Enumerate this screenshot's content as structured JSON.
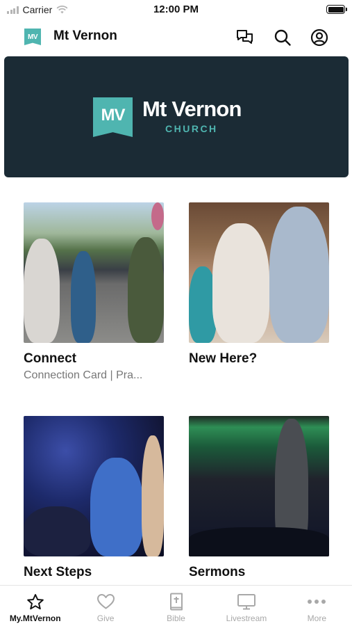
{
  "status": {
    "carrier": "Carrier",
    "time": "12:00 PM"
  },
  "header": {
    "logo_text": "MV",
    "title": "Mt Vernon"
  },
  "banner": {
    "mark": "MV",
    "name": "Mt Vernon",
    "subtitle": "CHURCH"
  },
  "cards": [
    {
      "title": "Connect",
      "subtitle": "Connection Card | Pra..."
    },
    {
      "title": "New Here?",
      "subtitle": ""
    },
    {
      "title": "Next Steps",
      "subtitle": ""
    },
    {
      "title": "Sermons",
      "subtitle": ""
    }
  ],
  "tabs": [
    {
      "label": "My.MtVernon",
      "icon": "star-icon",
      "active": true
    },
    {
      "label": "Give",
      "icon": "heart-icon",
      "active": false
    },
    {
      "label": "Bible",
      "icon": "bible-icon",
      "active": false
    },
    {
      "label": "Livestream",
      "icon": "tv-icon",
      "active": false
    },
    {
      "label": "More",
      "icon": "more-icon",
      "active": false
    }
  ],
  "colors": {
    "brand_teal": "#4fb5b0",
    "banner_navy": "#1b2b35"
  }
}
